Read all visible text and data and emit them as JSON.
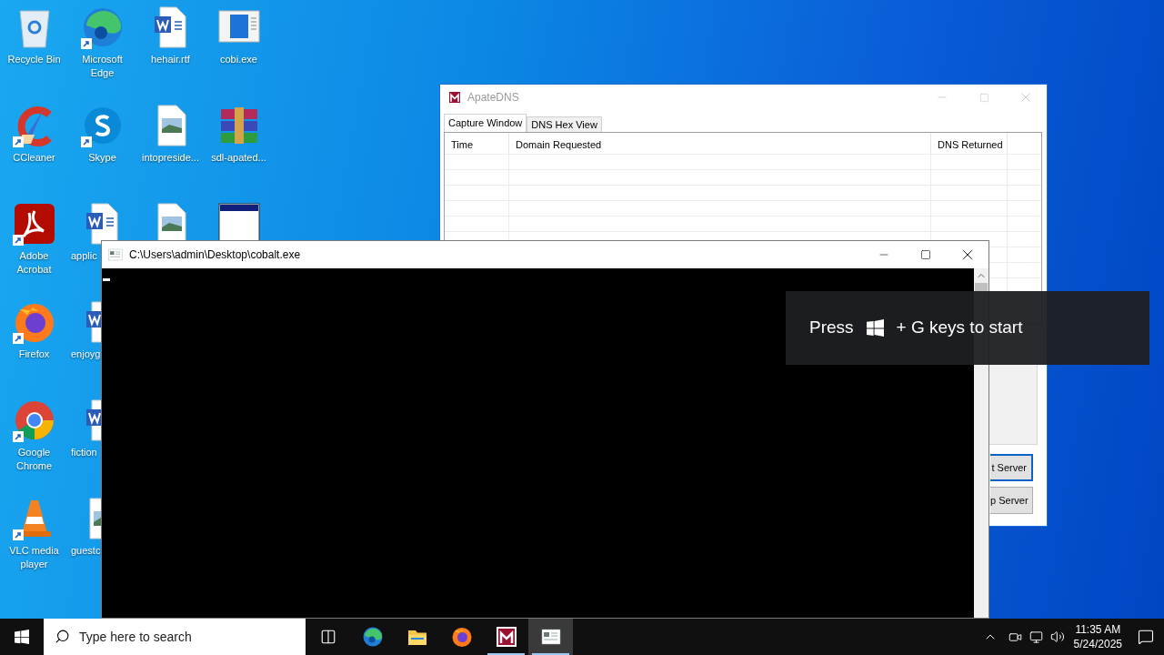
{
  "desktop": {
    "columns": [
      [
        {
          "label": "Recycle Bin",
          "kind": "recycle-bin",
          "shortcut": false
        },
        {
          "label": "CCleaner",
          "kind": "ccleaner",
          "shortcut": true
        },
        {
          "label": "Adobe Acrobat",
          "kind": "acrobat",
          "shortcut": true
        },
        {
          "label": "Firefox",
          "kind": "firefox",
          "shortcut": true
        },
        {
          "label": "Google Chrome",
          "kind": "chrome",
          "shortcut": true
        },
        {
          "label": "VLC media player",
          "kind": "vlc",
          "shortcut": true
        }
      ],
      [
        {
          "label": "Microsoft Edge",
          "kind": "edge",
          "shortcut": true
        },
        {
          "label": "Skype",
          "kind": "skype",
          "shortcut": true
        },
        {
          "label": "applic",
          "kind": "word",
          "shortcut": false,
          "cut": true
        },
        {
          "label": "enjoyg",
          "kind": "word",
          "shortcut": false,
          "cut": true
        },
        {
          "label": "fiction",
          "kind": "word",
          "shortcut": false,
          "cut": true
        },
        {
          "label": "guestc",
          "kind": "image",
          "shortcut": false,
          "cut": true
        }
      ],
      [
        {
          "label": "hehair.rtf",
          "kind": "word",
          "shortcut": false
        },
        {
          "label": "intopreside...",
          "kind": "image",
          "shortcut": false
        },
        {
          "kind": "image",
          "shortcut": false
        }
      ],
      [
        {
          "label": "cobi.exe",
          "kind": "exe",
          "shortcut": false
        },
        {
          "label": "sdl-apated...",
          "kind": "rar",
          "shortcut": false
        },
        {
          "kind": "app-window",
          "shortcut": false
        }
      ]
    ]
  },
  "apatedns": {
    "title": "ApateDNS",
    "active": false,
    "tabs": [
      {
        "label": "Capture Window",
        "selected": true
      },
      {
        "label": "DNS Hex View",
        "selected": false
      }
    ],
    "columns": [
      "Time",
      "Domain Requested",
      "DNS Returned"
    ],
    "buttons": [
      {
        "label": "t Server",
        "focused": true
      },
      {
        "label": "p Server",
        "focused": false
      }
    ]
  },
  "console": {
    "title": "C:\\Users\\admin\\Desktop\\cobalt.exe",
    "active": true
  },
  "toast": {
    "before": "Press",
    "after": "+ G keys to start"
  },
  "taskbar": {
    "search_placeholder": "Type here to search",
    "apps": [
      {
        "kind": "task-view",
        "active": false,
        "running": false
      },
      {
        "kind": "edge",
        "active": false,
        "running": false
      },
      {
        "kind": "explorer",
        "active": false,
        "running": false
      },
      {
        "kind": "firefox",
        "active": false,
        "running": false
      },
      {
        "kind": "apatedns",
        "active": false,
        "running": true
      },
      {
        "kind": "console",
        "active": true,
        "running": true
      }
    ],
    "clock": {
      "time": "11:35 AM",
      "date": "5/24/2025"
    }
  }
}
